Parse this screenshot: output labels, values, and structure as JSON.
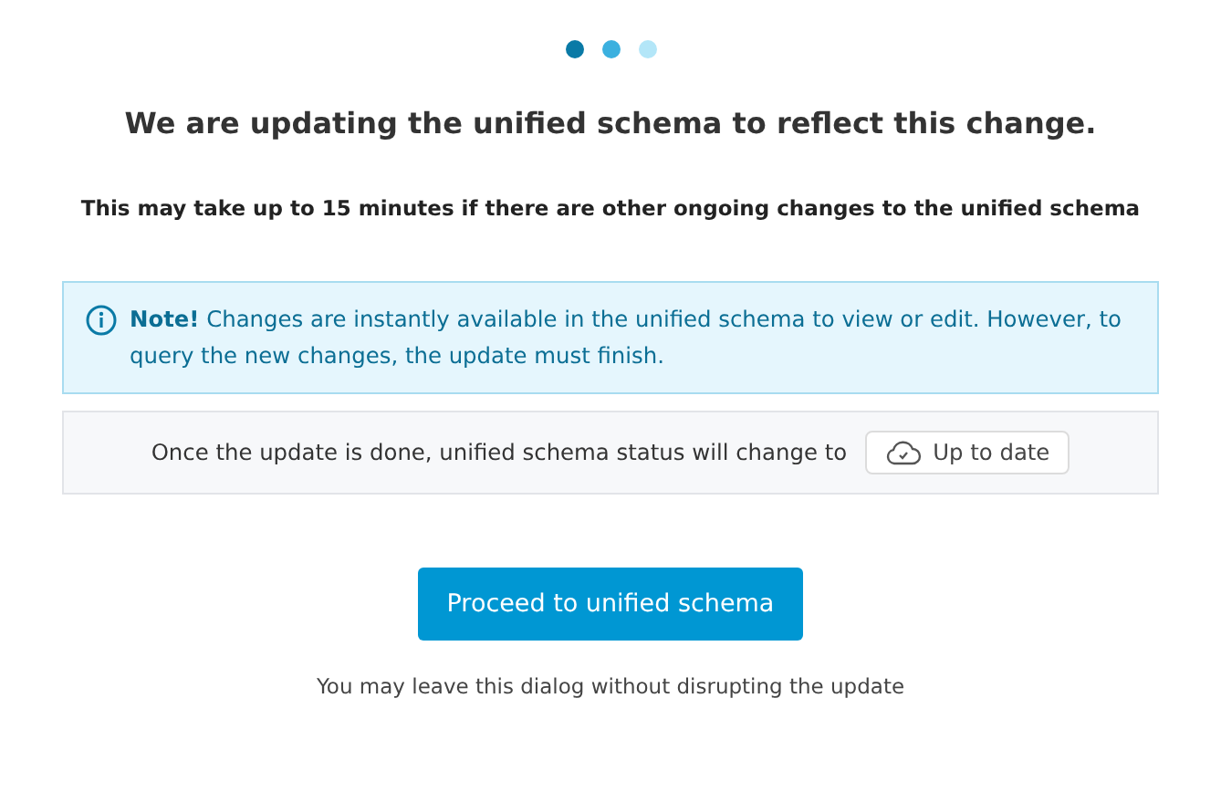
{
  "steps": [
    {
      "color": "#0a7aa6"
    },
    {
      "color": "#3bb0df"
    },
    {
      "color": "#b3e6f8"
    }
  ],
  "title": "We are updating the unified schema to reflect this change.",
  "subtitle": "This may take up to 15 minutes if there are other ongoing changes to the unified schema",
  "note": {
    "text": "**Note!** Changes are instantly available in the unified schema to view or edit. However, to query the new changes, the update must finish."
  },
  "status": {
    "text": "Once the update is done, unified schema status will change to",
    "badge": "Up to date"
  },
  "button": "Proceed to unified schema",
  "footnote": "You may leave this dialog without disrupting the update"
}
